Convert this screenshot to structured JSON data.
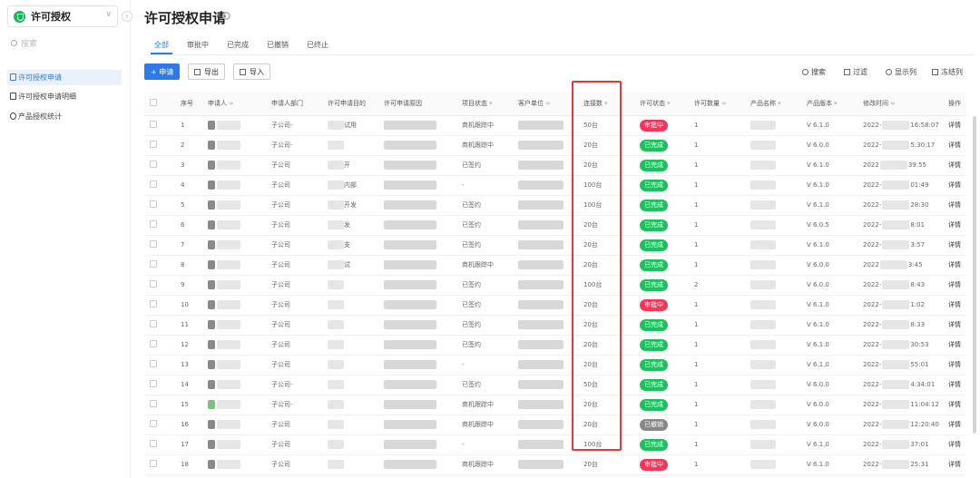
{
  "sidebar": {
    "app_title": "许可授权",
    "search_placeholder": "搜索",
    "items": [
      {
        "label": "许可授权申请",
        "active": true
      },
      {
        "label": "许可授权申请明细",
        "active": false
      },
      {
        "label": "产品授权统计",
        "active": false
      }
    ]
  },
  "page_title": "许可授权申请",
  "tabs": [
    {
      "label": "全部",
      "active": true
    },
    {
      "label": "审批中",
      "active": false
    },
    {
      "label": "已完成",
      "active": false
    },
    {
      "label": "已撤销",
      "active": false
    },
    {
      "label": "已终止",
      "active": false
    }
  ],
  "toolbar": {
    "apply": "+ 申请",
    "export": "导出",
    "import": "导入",
    "search": "搜索",
    "filter": "过滤",
    "columns": "显示列",
    "freeze": "冻结列"
  },
  "columns": [
    "序号",
    "申请人",
    "申请人部门",
    "许可申请目的",
    "许可申请原因",
    "项目状态",
    "客户单位",
    "连接数",
    "许可状态",
    "许可数量",
    "产品名称",
    "产品版本",
    "修改时间",
    "操作"
  ],
  "status_colors": {
    "审批中": "#f2385a",
    "已完成": "#19c25a",
    "已撤销": "#888888"
  },
  "rows": [
    {
      "no": "1",
      "dept": "子公司-",
      "purpose": "试用",
      "project": "商机跟踪中",
      "conn": "50台",
      "status": "审批中",
      "status_type": "red",
      "qty": "1",
      "version": "V 6.1.0",
      "date": "2022-",
      "time": "16:58:07",
      "op": "详情"
    },
    {
      "no": "2",
      "dept": "子公司-",
      "purpose": "",
      "project": "商机跟踪中",
      "conn": "20台",
      "status": "已完成",
      "status_type": "green",
      "qty": "1",
      "version": "V 6.0.0",
      "date": "2022-",
      "time": "5:30:17",
      "op": "详情"
    },
    {
      "no": "3",
      "dept": "子公司",
      "purpose": "开",
      "project": "已签约",
      "conn": "20台",
      "status": "已完成",
      "status_type": "green",
      "qty": "1",
      "version": "V 6.1.0",
      "date": "2022",
      "time": "39:55",
      "op": "详情"
    },
    {
      "no": "4",
      "dept": "子公司",
      "purpose": "内部",
      "project": "-",
      "conn": "100台",
      "status": "已完成",
      "status_type": "green",
      "qty": "1",
      "version": "V 6.1.0",
      "date": "2022-",
      "time": "01:49",
      "op": "详情"
    },
    {
      "no": "5",
      "dept": "子公司",
      "purpose": "开发",
      "project": "已签约",
      "conn": "100台",
      "status": "已完成",
      "status_type": "green",
      "qty": "1",
      "version": "V 6.1.0",
      "date": "2022-",
      "time": "28:30",
      "op": "详情"
    },
    {
      "no": "6",
      "dept": "子公司",
      "purpose": "发",
      "project": "已签约",
      "conn": "20台",
      "status": "已完成",
      "status_type": "green",
      "qty": "1",
      "version": "V 6.0.5",
      "date": "2022-",
      "time": "8:01",
      "op": "详情"
    },
    {
      "no": "7",
      "dept": "子公司",
      "purpose": "支",
      "project": "已签约",
      "conn": "20台",
      "status": "已完成",
      "status_type": "green",
      "qty": "1",
      "version": "V 6.1.0",
      "date": "2022-",
      "time": "3:57",
      "op": "详情"
    },
    {
      "no": "8",
      "dept": "子公司",
      "purpose": "试",
      "project": "商机跟踪中",
      "conn": "20台",
      "status": "已完成",
      "status_type": "green",
      "qty": "1",
      "version": "V 6.0.0",
      "date": "2022",
      "time": "3:45",
      "op": "详情"
    },
    {
      "no": "9",
      "dept": "子公司",
      "purpose": "",
      "project": "已签约",
      "conn": "100台",
      "status": "已完成",
      "status_type": "green",
      "qty": "2",
      "version": "V 6.0.0",
      "date": "2022-",
      "time": "8:43",
      "op": "详情"
    },
    {
      "no": "10",
      "dept": "子公司",
      "purpose": "",
      "project": "已签约",
      "conn": "20台",
      "status": "审批中",
      "status_type": "red",
      "qty": "1",
      "version": "V 6.1.0",
      "date": "2022-",
      "time": "1:02",
      "op": "详情"
    },
    {
      "no": "11",
      "dept": "子公司",
      "purpose": "",
      "project": "已签约",
      "conn": "20台",
      "status": "已完成",
      "status_type": "green",
      "qty": "1",
      "version": "V 6.1.0",
      "date": "2022-",
      "time": "8:33",
      "op": "详情"
    },
    {
      "no": "12",
      "dept": "子公司",
      "purpose": "",
      "project": "已签约",
      "conn": "20台",
      "status": "已完成",
      "status_type": "green",
      "qty": "1",
      "version": "V 6.1.0",
      "date": "2022-",
      "time": "30:53",
      "op": "详情"
    },
    {
      "no": "13",
      "dept": "子公司",
      "purpose": "",
      "project": "-",
      "conn": "20台",
      "status": "已完成",
      "status_type": "green",
      "qty": "1",
      "version": "V 6.1.0",
      "date": "2022-",
      "time": "55:01",
      "op": "详情"
    },
    {
      "no": "14",
      "dept": "子公司-",
      "purpose": "",
      "project": "已签约",
      "conn": "50台",
      "status": "已完成",
      "status_type": "green",
      "qty": "1",
      "version": "V 6.0.0",
      "date": "2022-",
      "time": "4:34:01",
      "op": "详情"
    },
    {
      "no": "15",
      "dept": "子公司-",
      "purpose": "",
      "project": "商机跟踪中",
      "conn": "20台",
      "status": "已完成",
      "status_type": "green",
      "qty": "1",
      "version": "V 6.0.0",
      "date": "2022-",
      "time": "11:04:12",
      "op": "详情"
    },
    {
      "no": "16",
      "dept": "子公司",
      "purpose": "",
      "project": "商机跟踪中",
      "conn": "20台",
      "status": "已撤销",
      "status_type": "gray",
      "qty": "1",
      "version": "V 6.0.0",
      "date": "2022-",
      "time": "12:20:40",
      "op": "详情"
    },
    {
      "no": "17",
      "dept": "子公司",
      "purpose": "",
      "project": "-",
      "conn": "100台",
      "status": "已完成",
      "status_type": "green",
      "qty": "1",
      "version": "V 6.1.0",
      "date": "2022-",
      "time": "37:01",
      "op": "详情"
    },
    {
      "no": "18",
      "dept": "子公司",
      "purpose": "",
      "project": "商机跟踪中",
      "conn": "20台",
      "status": "审批中",
      "status_type": "red",
      "qty": "1",
      "version": "V 6.1.0",
      "date": "2022-",
      "time": "25:31",
      "op": "详情"
    }
  ]
}
